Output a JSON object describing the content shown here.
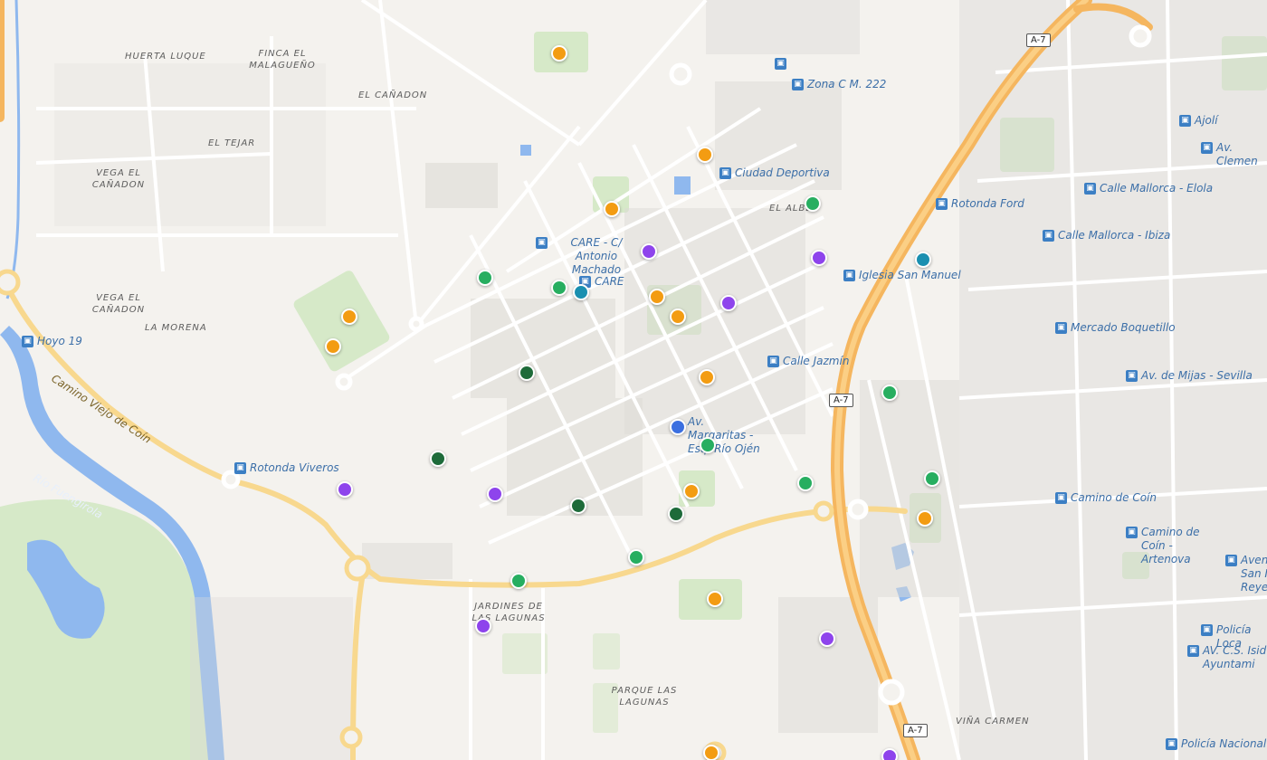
{
  "map": {
    "colors": {
      "land": "#f4f2ee",
      "building": "#dcdad6",
      "minor_road": "#ffffff",
      "arterial": "#f8d88e",
      "motorway": "#f5b65f",
      "water": "#8fb8ee",
      "park": "#d6e9c8",
      "marker_orange": "#f39c12",
      "marker_green": "#27ae60",
      "marker_darkgreen": "#1e6b3a",
      "marker_purple": "#8e44ec",
      "marker_teal": "#1a8fb0",
      "marker_blue": "#3b6fe0"
    },
    "places": [
      {
        "id": "huerta-luque",
        "text": "HUERTA LUQUE"
      },
      {
        "id": "finca-malagueno",
        "text": "FINCA EL MALAGUEÑO"
      },
      {
        "id": "el-canadon-1",
        "text": "EL CAÑADON"
      },
      {
        "id": "el-tejar",
        "text": "EL TEJAR"
      },
      {
        "id": "vega-el-canadon-1",
        "text": "VEGA EL CAÑADON"
      },
      {
        "id": "vega-el-canadon-2",
        "text": "VEGA EL CAÑADON"
      },
      {
        "id": "la-morena",
        "text": "LA MORENA"
      },
      {
        "id": "el-albero",
        "text": "EL ALBE"
      },
      {
        "id": "jardines",
        "text": "JARDINES DE LAS LAGUNAS"
      },
      {
        "id": "parque-lagunas",
        "text": "PARQUE LAS LAGUNAS"
      },
      {
        "id": "vina-carmen",
        "text": "VIÑA CARMEN"
      }
    ],
    "roads": [
      {
        "id": "camino-viejo",
        "text": "Camino Viejo de Coín"
      }
    ],
    "rivers": [
      {
        "id": "rio-fuengirola",
        "text": "Río Fuengirola"
      }
    ],
    "shields": [
      {
        "id": "a7-top",
        "text": "A-7"
      },
      {
        "id": "a7-mid",
        "text": "A-7"
      },
      {
        "id": "a7-bottom",
        "text": "A-7"
      }
    ],
    "stops": [
      {
        "id": "zona-c",
        "text": "Zona C M. 222"
      },
      {
        "id": "ciudad-deportiva",
        "text": "Ciudad Deportiva"
      },
      {
        "id": "care-machado",
        "text": "CARE - C/ Antonio Machado"
      },
      {
        "id": "care",
        "text": "CARE"
      },
      {
        "id": "rotonda-ford",
        "text": "Rotonda Ford"
      },
      {
        "id": "iglesia",
        "text": "Iglesia San Manuel"
      },
      {
        "id": "calle-jazmin",
        "text": "Calle Jazmín"
      },
      {
        "id": "margaritas",
        "text": "Av. Margaritas - Esq. Río Ojén"
      },
      {
        "id": "rotonda-viveros",
        "text": "Rotonda Viveros"
      },
      {
        "id": "hoyo-19",
        "text": "Hoyo 19"
      },
      {
        "id": "ajoli",
        "text": "Ajolí"
      },
      {
        "id": "clemente",
        "text": "Av. Clemen"
      },
      {
        "id": "mallorca-elola",
        "text": "Calle Mallorca - Elola"
      },
      {
        "id": "mallorca-ibiza",
        "text": "Calle Mallorca - Ibiza"
      },
      {
        "id": "boquetillo",
        "text": "Mercado Boquetillo"
      },
      {
        "id": "mijas-sevilla",
        "text": "Av. de Mijas - Sevilla"
      },
      {
        "id": "camino-coin",
        "text": "Camino de Coín"
      },
      {
        "id": "coin-artenova",
        "text": "Camino de Coín - Artenova"
      },
      {
        "id": "avenida-san",
        "text": "Aveni San I Reye"
      },
      {
        "id": "policia-local",
        "text": "Policía Loca"
      },
      {
        "id": "ayuntamiento",
        "text": "AV. C.S. Isid Ayuntami"
      },
      {
        "id": "policia-nacional",
        "text": "Policía Nacional"
      }
    ],
    "markers": [
      {
        "id": 1,
        "color": "orange"
      },
      {
        "id": 2,
        "color": "orange"
      },
      {
        "id": 3,
        "color": "orange"
      },
      {
        "id": 4,
        "color": "orange"
      },
      {
        "id": 5,
        "color": "orange"
      },
      {
        "id": 6,
        "color": "orange"
      },
      {
        "id": 7,
        "color": "orange"
      },
      {
        "id": 8,
        "color": "orange"
      },
      {
        "id": 9,
        "color": "orange"
      },
      {
        "id": 10,
        "color": "orange"
      },
      {
        "id": 11,
        "color": "orange"
      },
      {
        "id": 12,
        "color": "orange"
      },
      {
        "id": 13,
        "color": "green"
      },
      {
        "id": 14,
        "color": "green"
      },
      {
        "id": 15,
        "color": "green"
      },
      {
        "id": 16,
        "color": "green"
      },
      {
        "id": 17,
        "color": "green"
      },
      {
        "id": 18,
        "color": "green"
      },
      {
        "id": 19,
        "color": "green"
      },
      {
        "id": 20,
        "color": "green"
      },
      {
        "id": 21,
        "color": "green"
      },
      {
        "id": 22,
        "color": "darkgreen"
      },
      {
        "id": 23,
        "color": "darkgreen"
      },
      {
        "id": 24,
        "color": "darkgreen"
      },
      {
        "id": 25,
        "color": "darkgreen"
      },
      {
        "id": 26,
        "color": "purple"
      },
      {
        "id": 27,
        "color": "purple"
      },
      {
        "id": 28,
        "color": "purple"
      },
      {
        "id": 29,
        "color": "purple"
      },
      {
        "id": 30,
        "color": "purple"
      },
      {
        "id": 31,
        "color": "purple"
      },
      {
        "id": 32,
        "color": "purple"
      },
      {
        "id": 33,
        "color": "purple"
      },
      {
        "id": 34,
        "color": "teal"
      },
      {
        "id": 35,
        "color": "teal"
      },
      {
        "id": 36,
        "color": "blue"
      }
    ]
  }
}
